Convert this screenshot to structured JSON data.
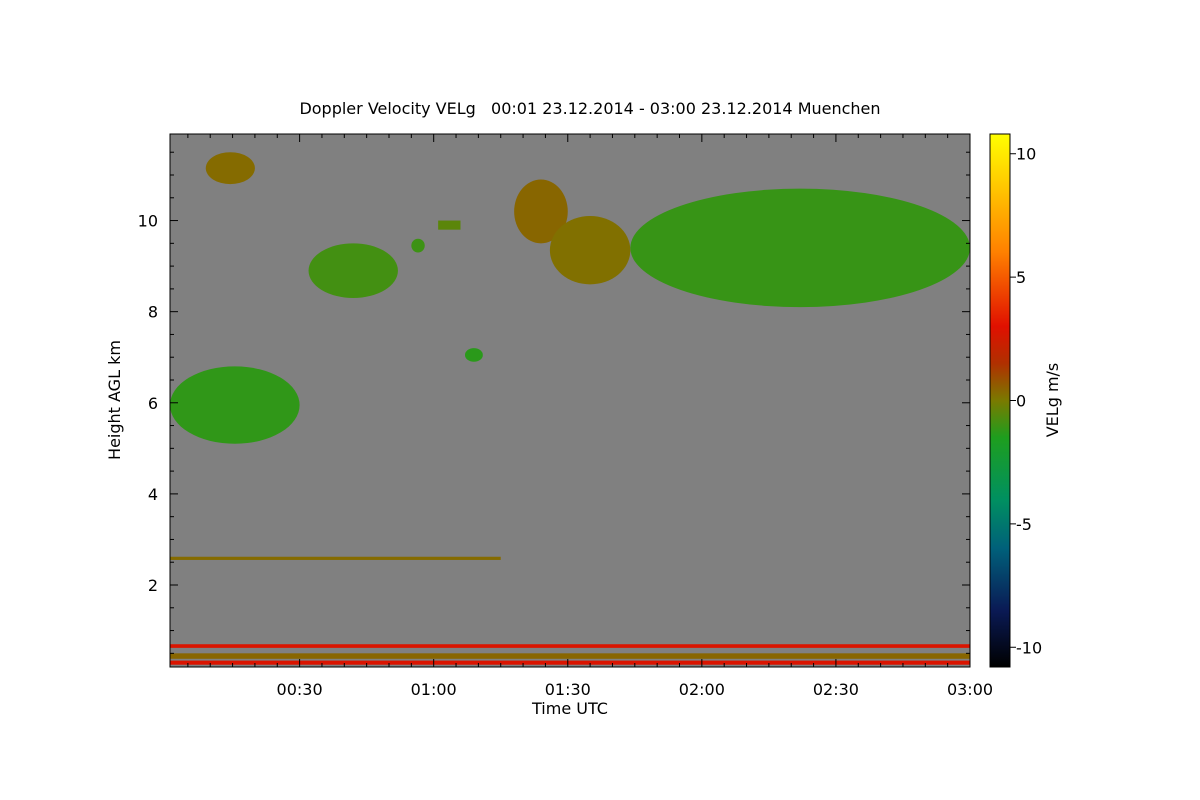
{
  "chart_data": {
    "type": "heatmap",
    "title": "Doppler Velocity VELg   00:01 23.12.2014 - 03:00 23.12.2014 Muenchen",
    "xlabel": "Time UTC",
    "ylabel": "Height AGL km",
    "xlim_minutes": [
      1,
      180
    ],
    "ylim_km": [
      0.2,
      11.9
    ],
    "x_ticks": [
      {
        "minutes": 30,
        "label": "00:30"
      },
      {
        "minutes": 60,
        "label": "01:00"
      },
      {
        "minutes": 90,
        "label": "01:30"
      },
      {
        "minutes": 120,
        "label": "02:00"
      },
      {
        "minutes": 150,
        "label": "02:30"
      },
      {
        "minutes": 180,
        "label": "03:00"
      }
    ],
    "y_ticks": [
      2,
      4,
      6,
      8,
      10
    ],
    "background_color": "#808080",
    "colorbar": {
      "label": "VELg m/s",
      "range": [
        -10.8,
        10.8
      ],
      "ticks": [
        10,
        5,
        0,
        -5,
        -10
      ],
      "stops": [
        {
          "value": -10.8,
          "color": "#000000"
        },
        {
          "value": -8.5,
          "color": "#0a1a55"
        },
        {
          "value": -6.0,
          "color": "#00607a"
        },
        {
          "value": -4.0,
          "color": "#009060"
        },
        {
          "value": -1.5,
          "color": "#1e9e1e"
        },
        {
          "value": 0.0,
          "color": "#7a7a00"
        },
        {
          "value": 1.5,
          "color": "#b03000"
        },
        {
          "value": 3.0,
          "color": "#e01000"
        },
        {
          "value": 6.0,
          "color": "#ff8000"
        },
        {
          "value": 9.0,
          "color": "#ffd000"
        },
        {
          "value": 10.8,
          "color": "#ffff00"
        }
      ]
    },
    "echo_regions": [
      {
        "t_start": 1,
        "t_end": 30,
        "h_bottom": 5.1,
        "h_top": 6.8,
        "velocity": -1.2
      },
      {
        "t_start": 9,
        "t_end": 20,
        "h_bottom": 10.8,
        "h_top": 11.5,
        "velocity": 0.3
      },
      {
        "t_start": 32,
        "t_end": 52,
        "h_bottom": 8.3,
        "h_top": 9.5,
        "velocity": -0.9
      },
      {
        "t_start": 55,
        "t_end": 58,
        "h_bottom": 9.3,
        "h_top": 9.6,
        "velocity": -1.0
      },
      {
        "t_start": 61,
        "t_end": 66,
        "h_bottom": 9.8,
        "h_top": 10.0,
        "velocity": -0.5
      },
      {
        "t_start": 67,
        "t_end": 71,
        "h_bottom": 6.9,
        "h_top": 7.2,
        "velocity": -1.3
      },
      {
        "t_start": 78,
        "t_end": 90,
        "h_bottom": 9.5,
        "h_top": 10.9,
        "velocity": 0.4
      },
      {
        "t_start": 86,
        "t_end": 104,
        "h_bottom": 8.6,
        "h_top": 10.1,
        "velocity": 0.2
      },
      {
        "t_start": 104,
        "t_end": 180,
        "h_bottom": 8.1,
        "h_top": 10.7,
        "velocity": -1.1
      },
      {
        "t_start": 1,
        "t_end": 180,
        "h_bottom": 0.62,
        "h_top": 0.7,
        "velocity": 2.8
      },
      {
        "t_start": 1,
        "t_end": 180,
        "h_bottom": 0.38,
        "h_top": 0.5,
        "velocity": 0.4
      },
      {
        "t_start": 1,
        "t_end": 180,
        "h_bottom": 0.25,
        "h_top": 0.34,
        "velocity": 2.8
      },
      {
        "t_start": 1,
        "t_end": 75,
        "h_bottom": 2.55,
        "h_top": 2.62,
        "velocity": 0.3
      }
    ]
  }
}
